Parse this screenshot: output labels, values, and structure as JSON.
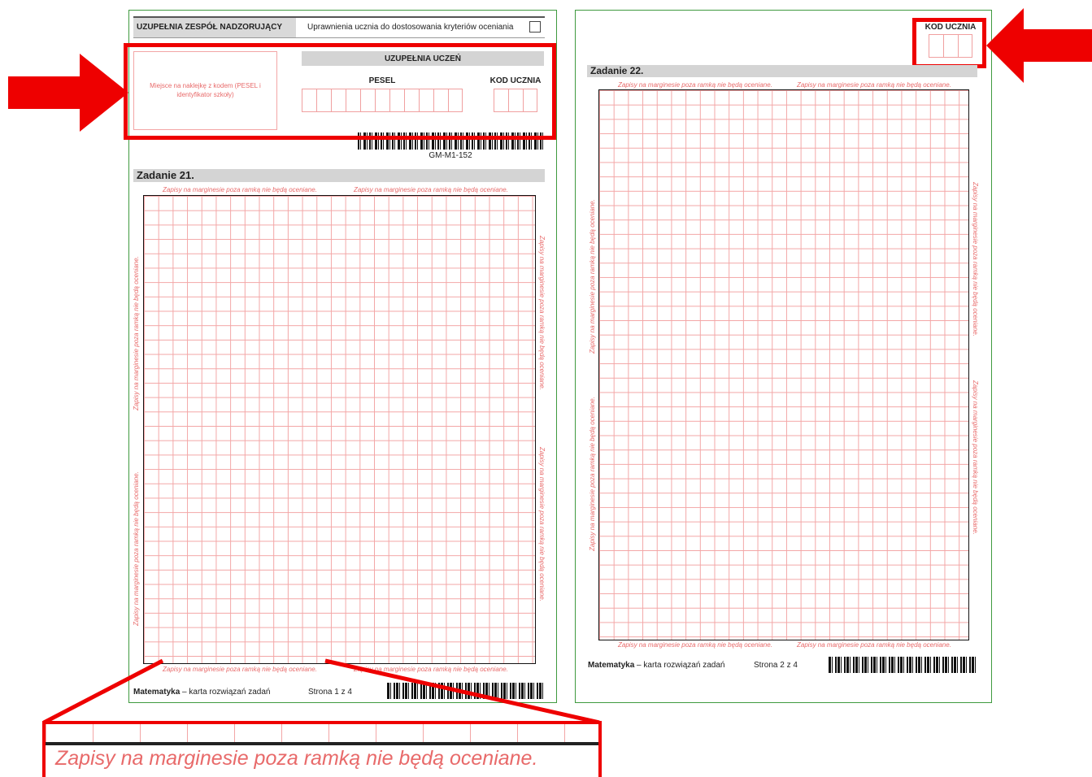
{
  "page1": {
    "supervisor_header": "UZUPEŁNIA ZESPÓŁ NADZORUJĄCY",
    "accommodation_label": "Uprawnienia ucznia do dostosowania kryteriów oceniania",
    "sticker_place": "Miejsce na naklejkę z kodem (PESEL i identyfikator szkoły)",
    "student_header": "UZUPEŁNIA UCZEŃ",
    "pesel_label": "PESEL",
    "student_code_label": "KOD UCZNIA",
    "sheet_code": "GM-M1-152",
    "task_title": "Zadanie 21.",
    "footer_subject": "Matematyka",
    "footer_desc": " – karta rozwiązań zadań",
    "footer_page": "Strona 1 z 4"
  },
  "page2": {
    "student_code_label": "KOD UCZNIA",
    "task_title": "Zadanie 22.",
    "footer_subject": "Matematyka",
    "footer_desc": " – karta rozwiązań zadań",
    "footer_page": "Strona 2 z 4"
  },
  "margin_note": "Zapisy na marginesie poza ramką nie będą oceniane.",
  "zoom_note": "Zapisy na marginesie poza ramką nie będą oceniane.",
  "colors": {
    "highlight": "#ee0000",
    "sheet_border": "#3f9a3f",
    "grid": "#f3a6a6",
    "note": "#e86a6a"
  }
}
